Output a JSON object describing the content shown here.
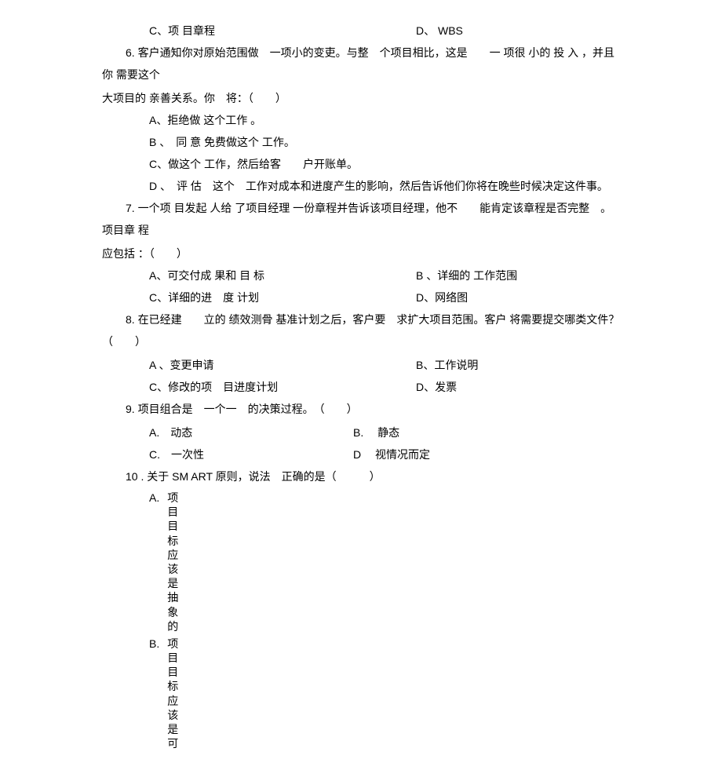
{
  "q5_options": {
    "c": "C、项 目章程",
    "d": "D、 WBS"
  },
  "q6": {
    "stem": "6.  客户通知你对原始范围做　一项小的变吏。与整　个项目相比，这是　　一 项很 小的 投 入 ，并且你 需要这个",
    "stem2": "大项目的 亲善关系。你　将：（　　）",
    "a": "A、拒绝做 这个工作 。",
    "b": "B 、　同 意 免费做这个 工作。",
    "c": "C、做这个 工作，然后给客　　户开账单。",
    "d": "D 、　评 估　这个　工作对成本和进度产生的影响，然后告诉他们你将在晚些时候决定这件事。"
  },
  "q7": {
    "stem": "7.   一个项 目发起 人给  了项目经理  一份章程并告诉该项目经理，他不　　能肯定该章程是否完整　。项目章 程",
    "stem2": "应包括 ：（　　）",
    "a": "A、可交付成   果和 目 标",
    "b": "B 、详细的 工作范围",
    "c": "C、详细的进　度 计划",
    "d": "D、网络图"
  },
  "q8": {
    "stem": "8.  在已经建　　立的 绩效测骨 基准计划之后，客户要　求扩大项目范围。客户  将需要提交哪类文件？　（　　）",
    "a": "A 、变更申请",
    "b": "B、工作说明",
    "c": "C、修改的项　目进度计划",
    "d": "D、发票"
  },
  "q9": {
    "stem": "9.  项目组合是　一个一　的决策过程。　（　　）",
    "a": "A.　动态",
    "b": "B.　 静态",
    "c": "C.　一次性",
    "d": "D　 视情况而定"
  },
  "q10": {
    "stem": "10 .  关于 SM ART  原则，说法　正确的是（　　　）",
    "a_label": "A.",
    "a_text": [
      "项",
      "目",
      "目",
      "标",
      "应",
      "该",
      "是",
      "抽",
      "象",
      "的"
    ],
    "b_label": "B.",
    "b_text": [
      "项",
      "目",
      "目",
      "标",
      "应",
      "该",
      "是",
      "可"
    ]
  }
}
